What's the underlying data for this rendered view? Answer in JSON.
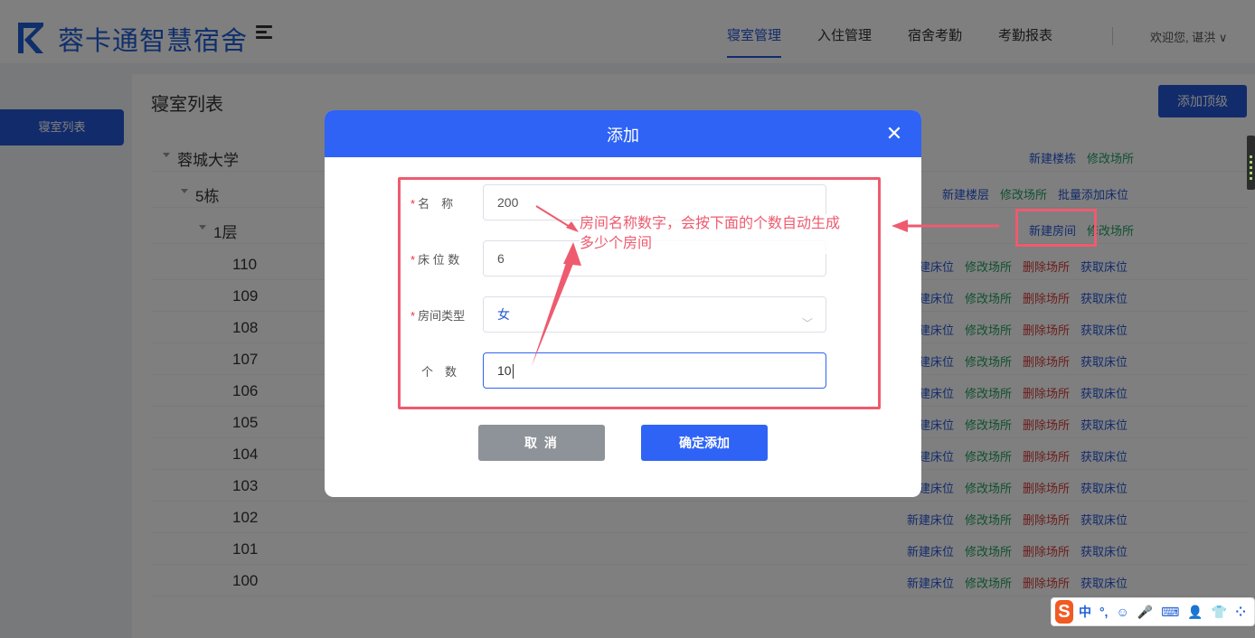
{
  "header": {
    "app_name": "蓉卡通智慧宿舍",
    "nav": [
      "寝室管理",
      "入住管理",
      "宿舍考勤",
      "考勤报表"
    ],
    "user_greeting": "欢迎您, 谌洪 ∨"
  },
  "sidebar": {
    "items": [
      {
        "label": "寝室列表"
      }
    ]
  },
  "main": {
    "title": "寝室列表",
    "add_top_label": "添加顶级",
    "tree": {
      "campus": {
        "name": "蓉城大学",
        "actions": [
          "新建楼栋",
          "修改场所"
        ]
      },
      "building": {
        "name": "5栋",
        "actions": [
          "新建楼层",
          "修改场所",
          "批量添加床位"
        ]
      },
      "floor": {
        "name": "1层",
        "actions": [
          "新建房间",
          "修改场所"
        ]
      },
      "room_actions": [
        "新建床位",
        "修改场所",
        "删除场所",
        "获取床位"
      ],
      "rooms": [
        "110",
        "109",
        "108",
        "107",
        "106",
        "105",
        "104",
        "103",
        "102",
        "101",
        "100"
      ]
    }
  },
  "dialog": {
    "title": "添加",
    "fields": {
      "name": {
        "label": "名　称",
        "value": "200"
      },
      "beds": {
        "label": "床 位 数",
        "value": "6"
      },
      "room_type": {
        "label": "房间类型",
        "value": "女"
      },
      "count": {
        "label": "个　数",
        "value": "10"
      }
    },
    "cancel_label": "取 消",
    "confirm_label": "确定添加"
  },
  "annotation": {
    "text": "房间名称数字，会按下面的个数自动生成多少个房间"
  },
  "ime": {
    "items": [
      "中",
      "°,",
      "☺",
      "🎤",
      "⌨",
      "👤",
      "👕",
      "⁘"
    ]
  },
  "colors": {
    "primary": "#2457d6",
    "dialog_header": "#2f63f6",
    "annotation": "#ee5b6f",
    "green": "#20a162",
    "red": "#d83b3b"
  }
}
